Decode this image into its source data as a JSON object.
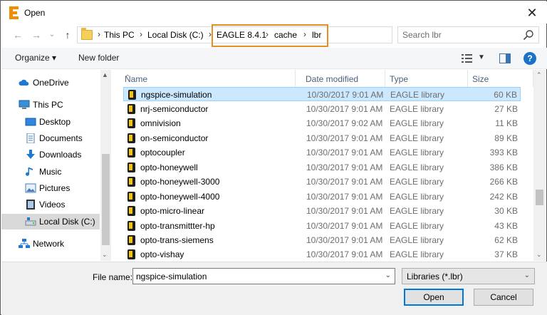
{
  "window": {
    "title": "Open",
    "app_icon": "eagle-logo-icon",
    "close_label": "✕"
  },
  "address_bar": {
    "breadcrumbs": [
      "This PC",
      "Local Disk (C:)",
      "EAGLE 8.4.1",
      "cache",
      "lbr"
    ],
    "separator": "›",
    "highlight_color": "#e58f23"
  },
  "search": {
    "placeholder": "Search lbr"
  },
  "toolbar": {
    "organize_label": "Organize ▾",
    "new_folder_label": "New folder"
  },
  "nav_pane": {
    "items": [
      {
        "label": "OneDrive",
        "icon": "cloud-icon"
      },
      {
        "label": "This PC",
        "icon": "computer-icon"
      },
      {
        "label": "Desktop",
        "icon": "desktop-icon"
      },
      {
        "label": "Documents",
        "icon": "documents-icon"
      },
      {
        "label": "Downloads",
        "icon": "downloads-icon"
      },
      {
        "label": "Music",
        "icon": "music-icon"
      },
      {
        "label": "Pictures",
        "icon": "pictures-icon"
      },
      {
        "label": "Videos",
        "icon": "videos-icon"
      },
      {
        "label": "Local Disk (C:)",
        "icon": "drive-icon",
        "selected": true
      },
      {
        "label": "Network",
        "icon": "network-icon"
      }
    ]
  },
  "file_list": {
    "columns": [
      "Name",
      "Date modified",
      "Type",
      "Size"
    ],
    "rows": [
      {
        "name": "ngspice-simulation",
        "date": "10/30/2017 9:01 AM",
        "type": "EAGLE library",
        "size": "60 KB",
        "selected": true
      },
      {
        "name": "nrj-semiconductor",
        "date": "10/30/2017 9:01 AM",
        "type": "EAGLE library",
        "size": "27 KB"
      },
      {
        "name": "omnivision",
        "date": "10/30/2017 9:02 AM",
        "type": "EAGLE library",
        "size": "11 KB"
      },
      {
        "name": "on-semiconductor",
        "date": "10/30/2017 9:01 AM",
        "type": "EAGLE library",
        "size": "89 KB"
      },
      {
        "name": "optocoupler",
        "date": "10/30/2017 9:01 AM",
        "type": "EAGLE library",
        "size": "393 KB"
      },
      {
        "name": "opto-honeywell",
        "date": "10/30/2017 9:01 AM",
        "type": "EAGLE library",
        "size": "386 KB"
      },
      {
        "name": "opto-honeywell-3000",
        "date": "10/30/2017 9:01 AM",
        "type": "EAGLE library",
        "size": "266 KB"
      },
      {
        "name": "opto-honeywell-4000",
        "date": "10/30/2017 9:01 AM",
        "type": "EAGLE library",
        "size": "242 KB"
      },
      {
        "name": "opto-micro-linear",
        "date": "10/30/2017 9:01 AM",
        "type": "EAGLE library",
        "size": "30 KB"
      },
      {
        "name": "opto-transmittter-hp",
        "date": "10/30/2017 9:01 AM",
        "type": "EAGLE library",
        "size": "43 KB"
      },
      {
        "name": "opto-trans-siemens",
        "date": "10/30/2017 9:01 AM",
        "type": "EAGLE library",
        "size": "62 KB"
      },
      {
        "name": "opto-vishay",
        "date": "10/30/2017 9:01 AM",
        "type": "EAGLE library",
        "size": "37 KB"
      }
    ]
  },
  "bottom": {
    "file_name_label": "File name:",
    "file_name_value": "ngspice-simulation",
    "file_type_value": "Libraries (*.lbr)",
    "open_label": "Open",
    "cancel_label": "Cancel"
  },
  "colors": {
    "accent": "#0078d7",
    "selection": "#cce8ff",
    "header_text": "#4c607a"
  }
}
